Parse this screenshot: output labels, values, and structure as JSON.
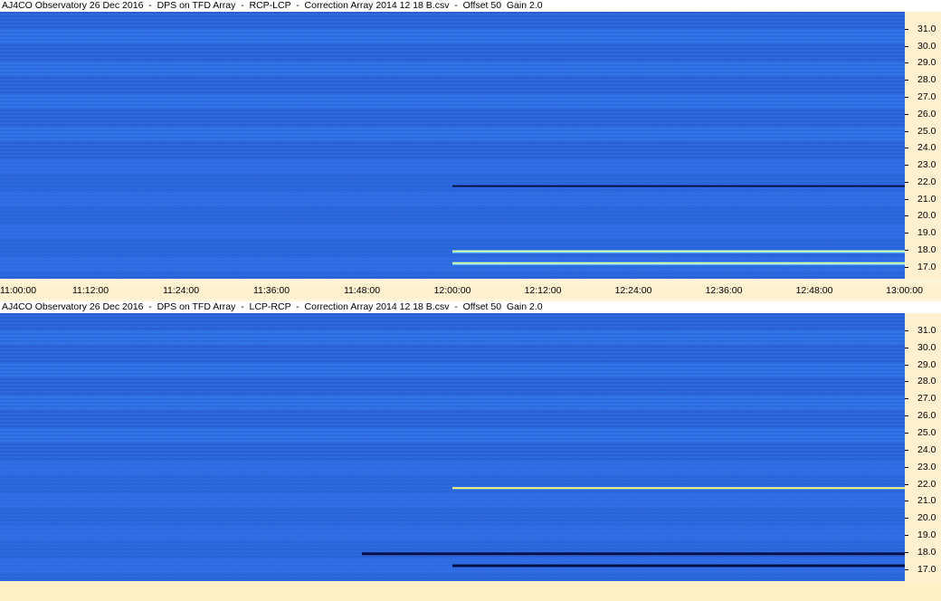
{
  "panels": [
    {
      "title": "AJ4CO Observatory 26 Dec 2016  -  DPS on TFD Array  -  RCP-LCP  -  Correction Array 2014 12 18 B.csv  -  Offset 50  Gain 2.0",
      "mode": "RCP-LCP"
    },
    {
      "title": "AJ4CO Observatory 26 Dec 2016  -  DPS on TFD Array  -  LCP-RCP  -  Correction Array 2014 12 18 B.csv  -  Offset 50  Gain 2.0",
      "mode": "LCP-RCP"
    }
  ],
  "colors": {
    "background_blue": "#2a64e0",
    "dark_band": "#1c3fa8",
    "light_band": "#3c86f0",
    "cyan_streak": "#8fe6ff",
    "yellow_streak": "#f6ff7a",
    "black_streak": "#05104a",
    "axis_bg": "#fff0d0"
  },
  "chart_data": [
    {
      "type": "heatmap",
      "title": "AJ4CO Observatory 26 Dec 2016  -  DPS on TFD Array  -  RCP-LCP  -  Correction Array 2014 12 18 B.csv  -  Offset 50  Gain 2.0",
      "xlabel": "",
      "ylabel": "",
      "x_ticks": [
        "11:00:00",
        "11:12:00",
        "11:24:00",
        "11:36:00",
        "11:48:00",
        "12:00:00",
        "12:12:00",
        "12:24:00",
        "12:36:00",
        "12:48:00",
        "13:00:00"
      ],
      "x_range": [
        "11:00:00",
        "13:00:00"
      ],
      "y_ticks": [
        "31.0",
        "30.0",
        "29.0",
        "28.0",
        "27.0",
        "26.0",
        "25.0",
        "24.0",
        "23.0",
        "22.0",
        "21.0",
        "20.0",
        "19.0",
        "18.0",
        "17.0"
      ],
      "y_range": [
        16.3,
        32.0
      ],
      "features": [
        {
          "kind": "dark-line",
          "freq": 21.75,
          "start": "12:00:00",
          "end": "13:00:00"
        },
        {
          "kind": "bright-band",
          "freq": 17.9,
          "start": "12:00:00",
          "end": "13:00:00"
        },
        {
          "kind": "bright-band",
          "freq": 17.2,
          "start": "12:00:00",
          "end": "13:00:00"
        }
      ]
    },
    {
      "type": "heatmap",
      "title": "AJ4CO Observatory 26 Dec 2016  -  DPS on TFD Array  -  LCP-RCP  -  Correction Array 2014 12 18 B.csv  -  Offset 50  Gain 2.0",
      "xlabel": "",
      "ylabel": "",
      "y_ticks": [
        "31.0",
        "30.0",
        "29.0",
        "28.0",
        "27.0",
        "26.0",
        "25.0",
        "24.0",
        "23.0",
        "22.0",
        "21.0",
        "20.0",
        "19.0",
        "18.0",
        "17.0"
      ],
      "y_range": [
        16.3,
        32.0
      ],
      "features": [
        {
          "kind": "bright-line",
          "freq": 21.75,
          "start": "12:00:00",
          "end": "13:00:00"
        },
        {
          "kind": "dark-band",
          "freq": 17.9,
          "start": "11:48:00",
          "end": "13:00:00"
        },
        {
          "kind": "dark-band",
          "freq": 17.2,
          "start": "12:00:00",
          "end": "13:00:00"
        }
      ]
    }
  ]
}
